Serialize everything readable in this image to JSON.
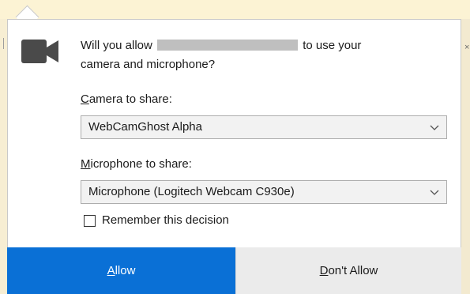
{
  "prompt": {
    "line1_before": "Will you allow",
    "line1_after": "to use your",
    "line2": "camera and microphone?"
  },
  "camera": {
    "label_accesskey": "C",
    "label_rest": "amera to share:",
    "selected": "WebCamGhost Alpha"
  },
  "microphone": {
    "label_accesskey": "M",
    "label_rest": "icrophone to share:",
    "selected": "Microphone (Logitech Webcam C930e)"
  },
  "remember": {
    "label": "Remember this decision",
    "checked": false
  },
  "buttons": {
    "allow_accesskey": "A",
    "allow_rest": "llow",
    "deny_accesskey": "D",
    "deny_rest": "on't Allow"
  },
  "background": {
    "close_glyph": "×"
  },
  "colors": {
    "allow_bg": "#0a70d6",
    "deny_bg": "#ebebeb",
    "page_bg": "#fcf3d4"
  },
  "icons": {
    "camera": "video-camera-icon",
    "chevron": "chevron-down-icon"
  }
}
